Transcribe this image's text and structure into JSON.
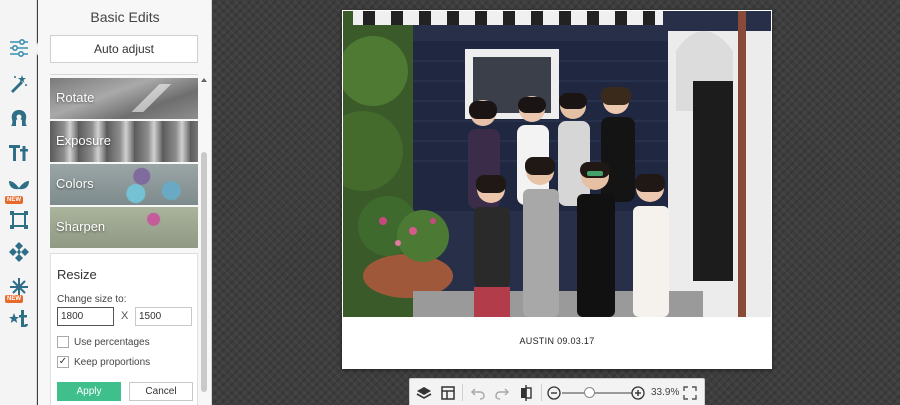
{
  "rail": {
    "tools": [
      {
        "name": "basic-edits-icon"
      },
      {
        "name": "effects-icon"
      },
      {
        "name": "touch-up-icon"
      },
      {
        "name": "text-icon"
      },
      {
        "name": "overlays-icon",
        "badge": "NEW"
      },
      {
        "name": "frames-icon"
      },
      {
        "name": "textures-icon"
      },
      {
        "name": "seasonal-icon",
        "badge": "NEW"
      },
      {
        "name": "themes-icon"
      }
    ],
    "badge_new": "NEW"
  },
  "panel": {
    "title": "Basic Edits",
    "auto_adjust": "Auto adjust",
    "tools": [
      "Rotate",
      "Exposure",
      "Colors",
      "Sharpen"
    ],
    "resize": {
      "title": "Resize",
      "change_size_label": "Change size to:",
      "width": "1800",
      "height": "1500",
      "x_label": "X",
      "use_percentages": "Use percentages",
      "use_percentages_checked": false,
      "keep_proportions": "Keep proportions",
      "keep_proportions_checked": true,
      "apply": "Apply",
      "cancel": "Cancel"
    }
  },
  "canvas": {
    "caption": "AUSTIN 09.03.17"
  },
  "toolbar": {
    "zoom_percent": "33.9%",
    "zoom_level": 0.34
  },
  "colors": {
    "accent": "#3fbf8c",
    "new_badge": "#e8692c",
    "icon": "#2e6e86"
  }
}
